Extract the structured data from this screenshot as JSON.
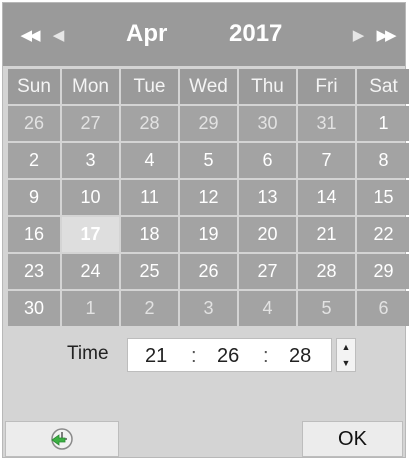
{
  "header": {
    "month": "Apr",
    "year": "2017",
    "prev_year_icon": "double-chevron-left",
    "prev_month_icon": "triangle-left",
    "next_month_icon": "triangle-right",
    "next_year_icon": "double-chevron-right"
  },
  "weekdays": [
    "Sun",
    "Mon",
    "Tue",
    "Wed",
    "Thu",
    "Fri",
    "Sat"
  ],
  "weeks": [
    [
      "26",
      "27",
      "28",
      "29",
      "30",
      "31",
      "1"
    ],
    [
      "2",
      "3",
      "4",
      "5",
      "6",
      "7",
      "8"
    ],
    [
      "9",
      "10",
      "11",
      "12",
      "13",
      "14",
      "15"
    ],
    [
      "16",
      "17",
      "18",
      "19",
      "20",
      "21",
      "22"
    ],
    [
      "23",
      "24",
      "25",
      "26",
      "27",
      "28",
      "29"
    ],
    [
      "30",
      "1",
      "2",
      "3",
      "4",
      "5",
      "6"
    ]
  ],
  "selected_day": "17",
  "time": {
    "label": "Time",
    "hours": "21",
    "minutes": "26",
    "seconds": "28",
    "separator": ":"
  },
  "footer": {
    "today_icon": "clock-icon",
    "ok_label": "OK"
  },
  "colors": {
    "header": "#9a9a9a",
    "cell": "#a3a3a3",
    "selected": "#dedede",
    "body": "#d4d4d4",
    "today_icon_green": "#3cb043"
  }
}
